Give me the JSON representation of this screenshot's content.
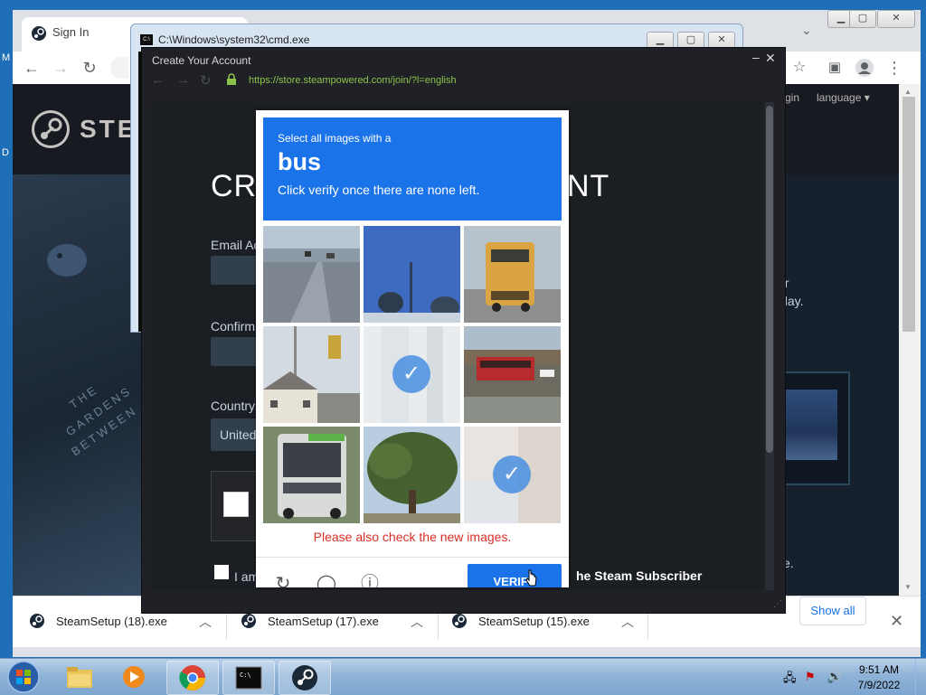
{
  "chrome": {
    "tab_title": "Sign In",
    "window_controls": [
      "minimize",
      "maximize",
      "close"
    ]
  },
  "steam_page": {
    "logo_text": "STEA",
    "title_left": "CR",
    "title_right": "NT",
    "email_label": "Email Ac",
    "confirm_label": "Confirm",
    "country_label": "Country",
    "country_value": "United",
    "agree_left": "I am",
    "agree_right": "he Steam Subscriber",
    "right_text_1": "er",
    "right_text_2": "play.",
    "right_text_3": "e.",
    "nav_login": "gin",
    "nav_language": "language",
    "gardens_text_1": "THE",
    "gardens_text_2": "GARDENS",
    "gardens_text_3": "BETWEEN"
  },
  "cmd_window": {
    "title": "C:\\Windows\\system32\\cmd.exe"
  },
  "steam_window": {
    "title": "Create Your Account",
    "url": "https://store.steampowered.com/join/?l=english"
  },
  "captcha": {
    "instruction_line1": "Select all images with a",
    "target": "bus",
    "instruction_line3": "Click verify once there are none left.",
    "error": "Please also check the new images.",
    "verify_label": "VERIFY",
    "tiles": [
      {
        "content": "highway",
        "selected": false
      },
      {
        "content": "sky-pole",
        "selected": false
      },
      {
        "content": "school-bus",
        "selected": false
      },
      {
        "content": "traffic-light",
        "selected": false
      },
      {
        "content": "faded",
        "selected": true
      },
      {
        "content": "red-bus",
        "selected": false
      },
      {
        "content": "city-bus",
        "selected": false
      },
      {
        "content": "tree",
        "selected": false
      },
      {
        "content": "faded",
        "selected": true
      }
    ]
  },
  "downloads": [
    {
      "name": "SteamSetup (18).exe"
    },
    {
      "name": "SteamSetup (17).exe"
    },
    {
      "name": "SteamSetup (15).exe"
    }
  ],
  "download_bar": {
    "show_all": "Show all"
  },
  "taskbar": {
    "time": "9:51 AM",
    "date": "7/9/2022",
    "apps": [
      "start",
      "explorer",
      "media-player",
      "chrome",
      "cmd",
      "steam"
    ]
  },
  "desktop_left": [
    "M",
    "D"
  ]
}
